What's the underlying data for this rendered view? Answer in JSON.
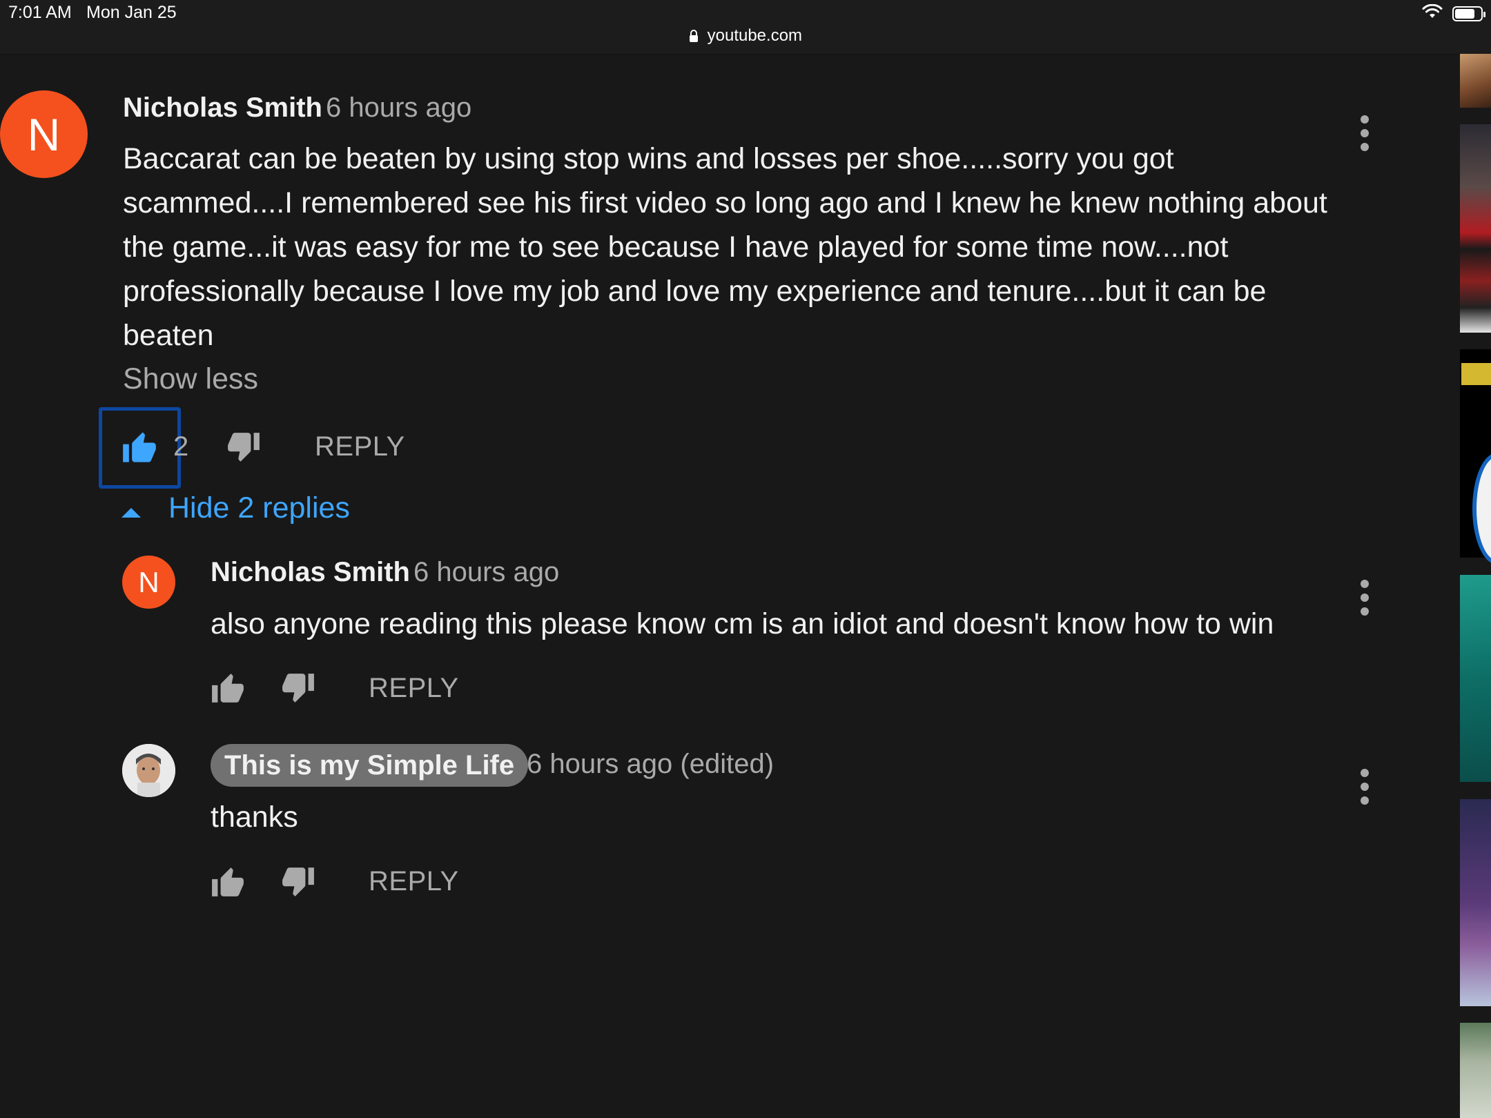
{
  "status_bar": {
    "time": "7:01 AM",
    "date": "Mon Jan 25",
    "url": "youtube.com"
  },
  "comment": {
    "avatar_letter": "N",
    "author": "Nicholas Smith",
    "time": "6 hours ago",
    "text": "Baccarat can be beaten by using stop wins and losses per shoe.....sorry you got scammed....I remembered see his first video so long ago and I knew he knew nothing about the game...it was easy for me to see because I have played for some time now....not professionally because I love my job and love my experience and tenure....but it can be beaten",
    "show_less_label": "Show less",
    "like_count": "2",
    "reply_label": "REPLY",
    "hide_replies_label": "Hide 2 replies"
  },
  "replies": [
    {
      "avatar_letter": "N",
      "author": "Nicholas Smith",
      "time": "6 hours ago",
      "text": "also anyone reading this please know cm is an idiot and doesn't know how to win",
      "reply_label": "REPLY"
    },
    {
      "author": "This is my Simple Life",
      "time": "6 hours ago (edited)",
      "text": "thanks",
      "reply_label": "REPLY"
    }
  ],
  "colors": {
    "background": "#181818",
    "accent_blue": "#3ea6ff",
    "avatar_orange": "#f4511e",
    "secondary_text": "#aaaaaa"
  }
}
